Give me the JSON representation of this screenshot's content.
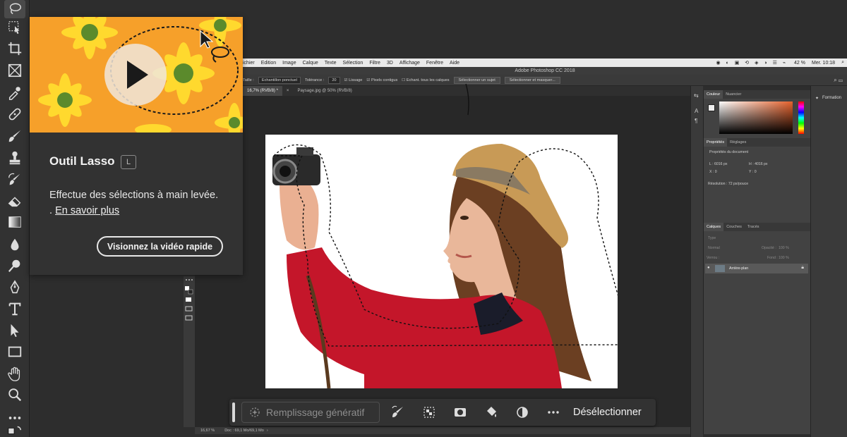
{
  "tooltip": {
    "title": "Outil Lasso",
    "shortcut": "L",
    "description": "Effectue des sélections à main levée.",
    "link_prefix": ".",
    "link_text": "En savoir plus",
    "video_button": "Visionnez la vidéo rapide"
  },
  "ps_menu": {
    "items": [
      "ichier",
      "Edition",
      "Image",
      "Calque",
      "Texte",
      "Sélection",
      "Filtre",
      "3D",
      "Affichage",
      "Fenêtre",
      "Aide"
    ],
    "battery": "42 %",
    "clock": "Mer. 10:18"
  },
  "ps_title": "Adobe Photoshop CC 2018",
  "options_bar": {
    "taille_label": "Taille :",
    "taille_value": "Echantillon ponctuel",
    "tolerance_label": "Tolérance :",
    "tolerance_value": "20",
    "lissage": "Lissage",
    "pixels_contigus": "Pixels contigus",
    "echant_calques": "Echant. tous les calques",
    "select_subject": "Sélectionner un sujet",
    "select_mask": "Sélectionner et masquer..."
  },
  "doc_tabs": [
    {
      "label": "16,7% (RVB/8) *",
      "active": true
    },
    {
      "label": "Paysage.jpg @ 50% (RVB/8)",
      "active": false
    }
  ],
  "statusbar": {
    "zoom": "16,67 %",
    "doc": "Doc : 69,1 Mo/69,1 Mo"
  },
  "panels": {
    "color_tabs": [
      "Couleur",
      "Nuancier"
    ],
    "props_tabs": [
      "Propriétés",
      "Réglages"
    ],
    "props_title": "Propriétés du document",
    "width_label": "L : 6016 px",
    "height_label": "H : 4016 px",
    "x_label": "X : 0",
    "y_label": "Y : 0",
    "resolution": "Résolution : 72 px/pouce",
    "layers_tabs": [
      "Calques",
      "Couches",
      "Tracés"
    ],
    "layer_type": "Type",
    "blend_mode": "Normal",
    "opacity_label": "Opacité :",
    "opacity_value": "100 %",
    "lock_label": "Verrou :",
    "fill_label": "Fond :",
    "fill_value": "100 %",
    "layer_name": "Arrière-plan",
    "formation": "Formation"
  },
  "taskbar": {
    "gen_fill": "Remplissage génératif",
    "deselect": "Désélectionner"
  },
  "colors": {
    "accent_orange": "#f6a02a",
    "selection_red": "#c4162a"
  }
}
